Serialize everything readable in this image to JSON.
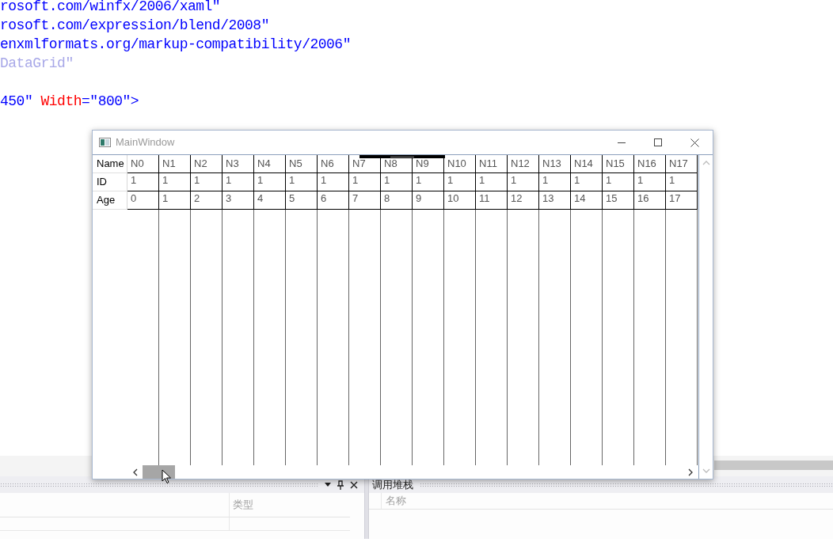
{
  "code_lines": [
    {
      "segments": [
        {
          "text": "rosoft.com/winfx/2006/xaml″",
          "kind": "value"
        }
      ]
    },
    {
      "segments": [
        {
          "text": "rosoft.com/expression/blend/2008″",
          "kind": "value"
        }
      ]
    },
    {
      "segments": [
        {
          "text": "enxmlformats.org/markup-compatibility/2006″",
          "kind": "value"
        }
      ]
    },
    {
      "segments": [
        {
          "text": "DataGrid″",
          "kind": "faded"
        }
      ]
    },
    {
      "blank_line_before": true,
      "segments": [
        {
          "text": "450″ ",
          "kind": "value"
        },
        {
          "text": "Width",
          "kind": "attribute"
        },
        {
          "text": "=″800″>",
          "kind": "value"
        }
      ]
    }
  ],
  "window": {
    "title": "MainWindow",
    "rows": [
      {
        "label": "Name",
        "kind": "header",
        "cells": [
          "N0",
          "N1",
          "N2",
          "N3",
          "N4",
          "N5",
          "N6",
          "N7",
          "N8",
          "N9",
          "N10",
          "N11",
          "N12",
          "N13",
          "N14",
          "N15",
          "N16",
          "N17"
        ]
      },
      {
        "label": "ID",
        "kind": "data",
        "cells": [
          "1",
          "1",
          "1",
          "1",
          "1",
          "1",
          "1",
          "1",
          "1",
          "1",
          "1",
          "1",
          "1",
          "1",
          "1",
          "1",
          "1",
          "1"
        ]
      },
      {
        "label": "Age",
        "kind": "data",
        "cells": [
          "0",
          "1",
          "2",
          "3",
          "4",
          "5",
          "6",
          "7",
          "8",
          "9",
          "10",
          "11",
          "12",
          "13",
          "14",
          "15",
          "16",
          "17"
        ]
      }
    ]
  },
  "bottom_left_panel": {
    "columns": [
      "类型"
    ]
  },
  "call_stack_panel": {
    "title": "调用堆栈",
    "columns": [
      "名称"
    ]
  }
}
